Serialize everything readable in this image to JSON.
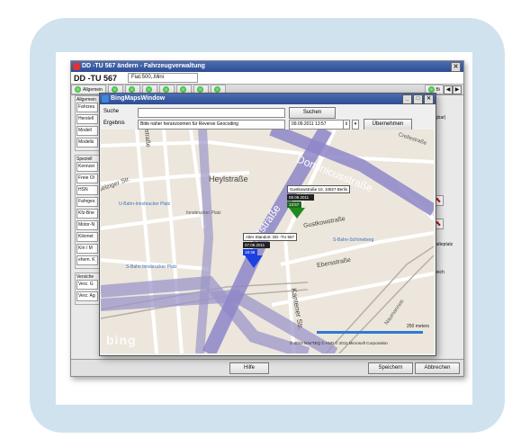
{
  "main_window": {
    "title": "DD -TU 567 ändern - Fahrzeugverwaltung",
    "plate": "DD -TU 567",
    "vehicle": "Fiat.500,.Mini",
    "tabs": [
      "Allgemein",
      "",
      "",
      "",
      "",
      "",
      "",
      "",
      "Bi"
    ],
    "left_groups": [
      {
        "title": "Allgemein",
        "items": [
          "Fahrzeu",
          "Herstell",
          "Modell",
          "Modells"
        ]
      },
      {
        "title": "Speziell",
        "items": [
          "Kennzei",
          "Freie Ol",
          "HSN",
          "Fahrges",
          "Kfz-Brie",
          "Motor-N",
          "Kilomet",
          "Km / M",
          "ehem. K"
        ]
      },
      {
        "title": "Versiche",
        "items": [
          "Verz. G",
          "Verz. Ag"
        ]
      }
    ],
    "right_texts": [
      "ugbar)",
      "Halteplatz",
      "weich"
    ],
    "buttons": {
      "help": "Hilfe",
      "save": "Speichern",
      "cancel": "Abbrechen"
    }
  },
  "bing_window": {
    "title": "BingMapsWindow",
    "search_label": "Suche",
    "search_value": "",
    "search_button": "Suchen",
    "result_label": "Ergebnis",
    "result_value": "Bitte näher heranzoomen für Reverse Geocoding",
    "datetime_value": "09.09.2011 13:57",
    "apply_button": "Übernehmen"
  },
  "map": {
    "streets": [
      "Hauptstraße",
      "Dominicusstraße",
      "Heylstraße",
      "Gustkowstraße",
      "Ebersstraße",
      "Kantener Str.",
      "Akazienstraße",
      "Innsbrucker Platz",
      "U-Bahn-Innsbrucker Platz",
      "S-Bahn Innsbrucker Platz",
      "S-Bahn-Schöneberg",
      "Crellestraße",
      "Belziger Str.",
      "Naumannstr."
    ],
    "pins": [
      {
        "label": "Gustkowstraße 10, 10827 Berlin",
        "date": "09.09.2011",
        "time": "13:57",
        "color": "#1f8a1f"
      },
      {
        "label": "Alter Standort: DD -TU 567",
        "date": "07.09.2011",
        "time": "18:36",
        "color": "#1b3fe0"
      }
    ],
    "scale_label": "250 meters",
    "copyright": "© 2010 NAVTEQ  © AND  © 2011 Microsoft Corporation",
    "logo": "bing"
  }
}
